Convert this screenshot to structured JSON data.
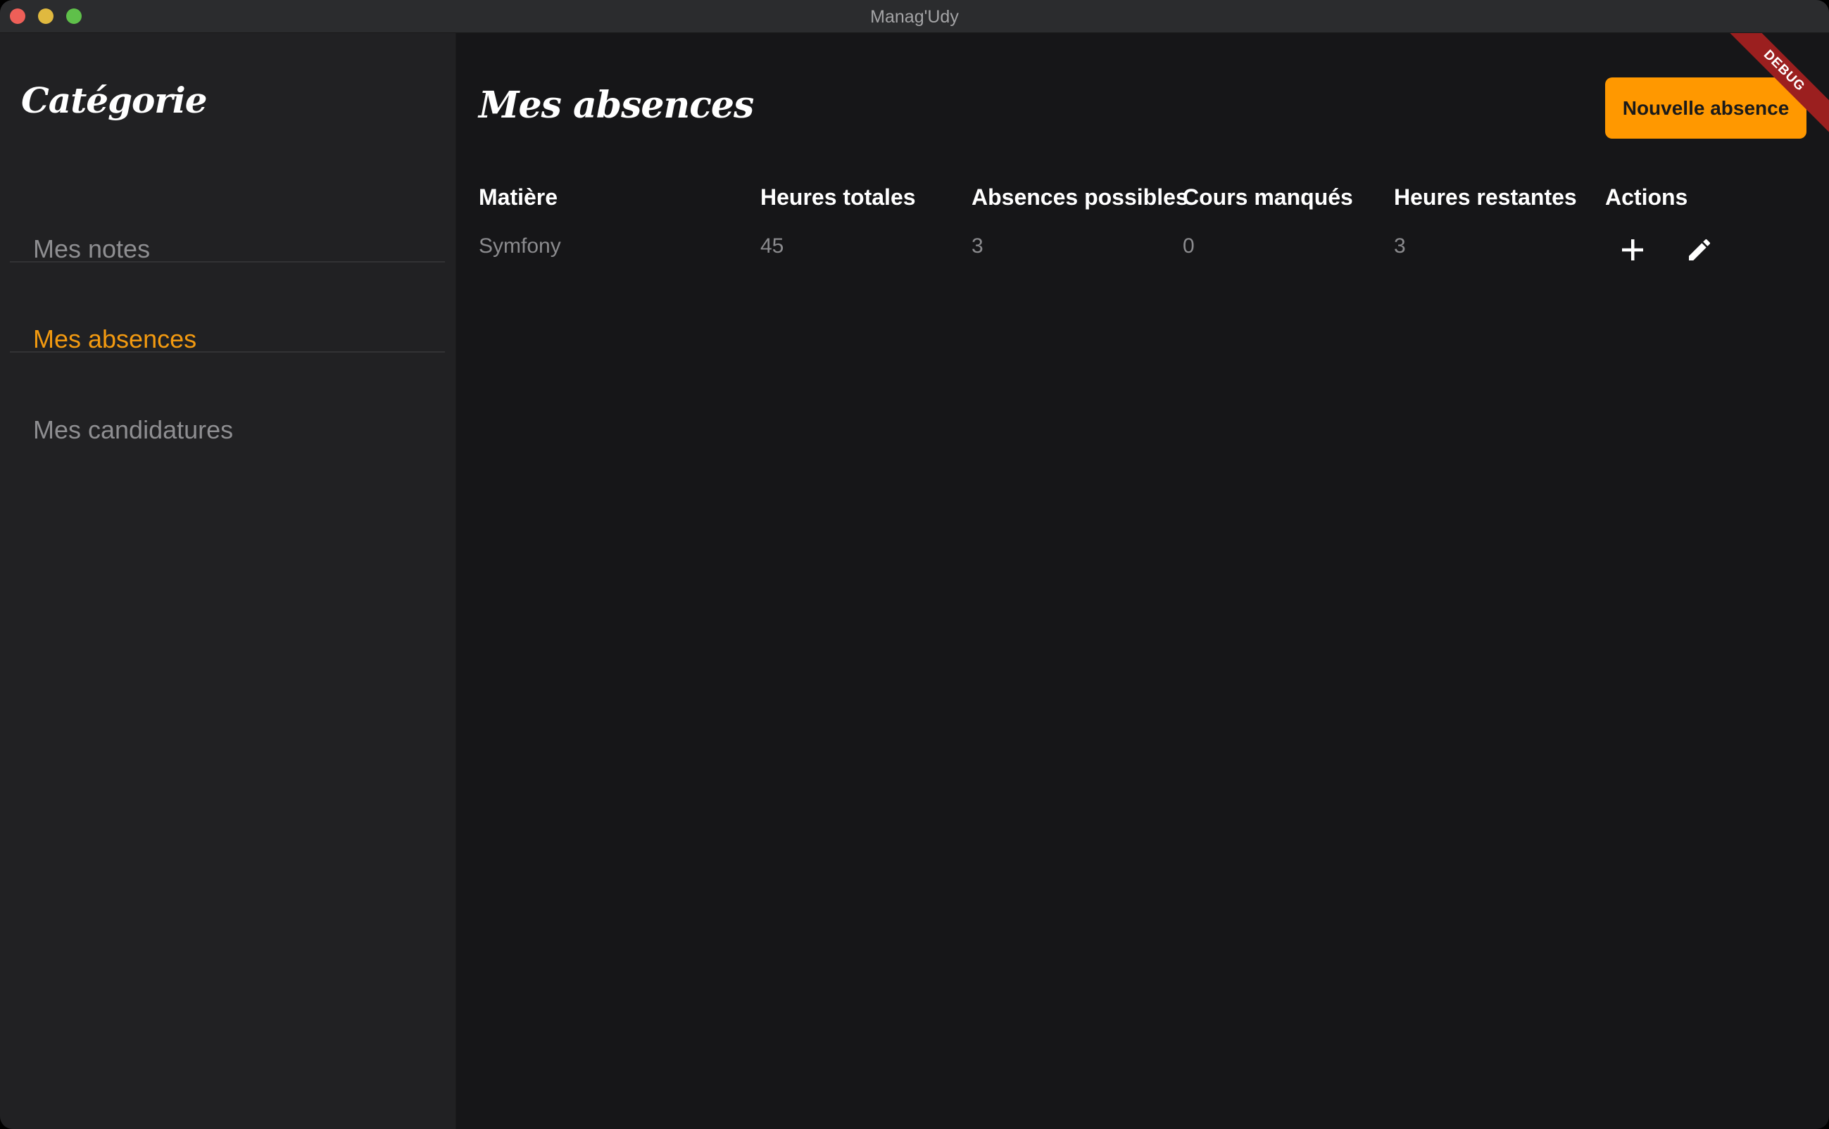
{
  "window": {
    "title": "Manag'Udy"
  },
  "sidebar": {
    "title": "Catégorie",
    "items": [
      {
        "label": "Mes notes",
        "active": false
      },
      {
        "label": "Mes absences",
        "active": true
      },
      {
        "label": "Mes candidatures",
        "active": false
      }
    ]
  },
  "main": {
    "title": "Mes absences",
    "new_button": "Nouvelle absence",
    "debug_badge": "DEBUG",
    "table": {
      "headers": [
        "Matière",
        "Heures totales",
        "Absences possibles",
        "Cours manqués",
        "Heures restantes",
        "Actions"
      ],
      "rows": [
        {
          "matiere": "Symfony",
          "heures_totales": "45",
          "absences_possibles": "3",
          "cours_manques": "0",
          "heures_restantes": "3",
          "actions": [
            "add-icon",
            "edit-icon"
          ]
        }
      ]
    }
  },
  "colors": {
    "accent": "#ff9800",
    "active_nav": "#f39a10",
    "sidebar_bg": "#212123",
    "main_bg": "#161618",
    "debug_ribbon": "#9b1f1f"
  }
}
